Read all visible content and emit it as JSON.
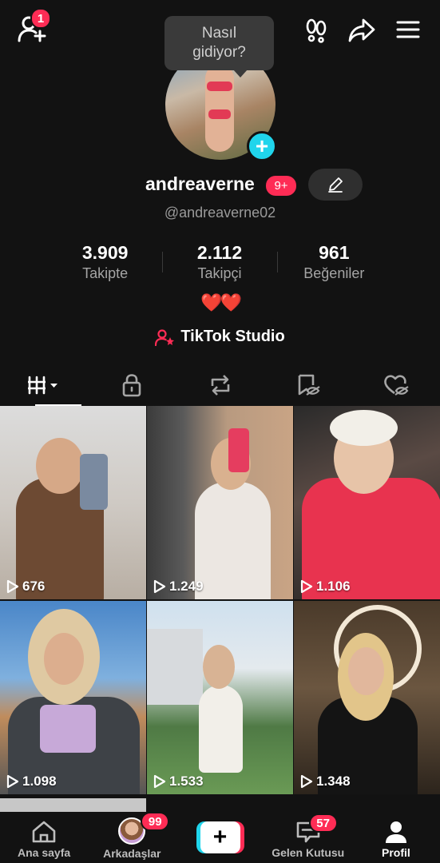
{
  "top_bar": {
    "add_friend_badge": "1"
  },
  "tooltip": {
    "line1": "Nasıl",
    "line2": "gidiyor?"
  },
  "profile": {
    "username": "andreaverne",
    "username_badge": "9+",
    "handle": "@andreaverne02",
    "stats": [
      {
        "value": "3.909",
        "label": "Takipte"
      },
      {
        "value": "2.112",
        "label": "Takipçi"
      },
      {
        "value": "961",
        "label": "Beğeniler"
      }
    ],
    "bio": "❤️❤️",
    "studio_label": "TikTok Studio"
  },
  "tabs": [
    {
      "name": "videos",
      "icon": "grid-icon",
      "active": true
    },
    {
      "name": "private",
      "icon": "lock-icon"
    },
    {
      "name": "reposts",
      "icon": "repost-icon"
    },
    {
      "name": "saved",
      "icon": "bookmark-eye-icon"
    },
    {
      "name": "liked",
      "icon": "heart-eye-icon"
    }
  ],
  "videos": [
    {
      "views": "676"
    },
    {
      "views": "1.249"
    },
    {
      "views": "1.106"
    },
    {
      "views": "1.098"
    },
    {
      "views": "1.533"
    },
    {
      "views": "1.348"
    }
  ],
  "bottom_nav": {
    "home": "Ana sayfa",
    "friends": "Arkadaşlar",
    "friends_badge": "99",
    "inbox": "Gelen Kutusu",
    "inbox_badge": "57",
    "profile": "Profil"
  },
  "colors": {
    "accent_red": "#fe2c55",
    "accent_cyan": "#20d5ec",
    "background": "#121212"
  }
}
